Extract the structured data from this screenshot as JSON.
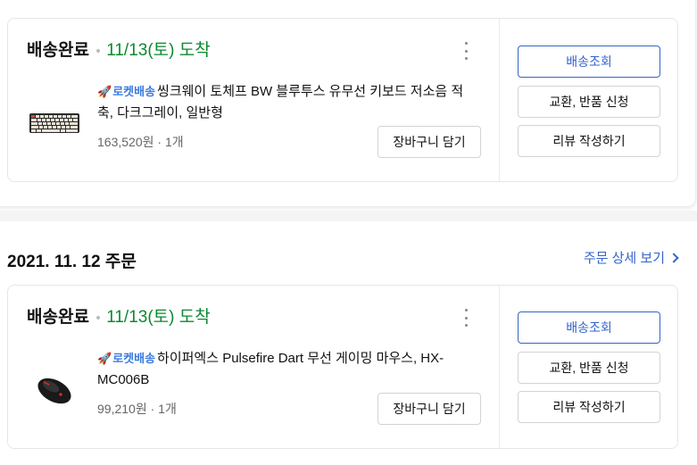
{
  "orders": [
    {
      "status": "배송완료",
      "arrival": "11/13(토) 도착",
      "badge": "로켓배송",
      "product_name": "씽크웨이 토체프 BW 블루투스 유무선 키보드 저소음 적축, 다크그레이, 일반형",
      "price": "163,520원",
      "quantity": "1개",
      "cart_button": "장바구니 담기",
      "actions": {
        "track": "배송조회",
        "return": "교환, 반품 신청",
        "review": "리뷰 작성하기"
      }
    },
    {
      "order_date": "2021. 11. 12 주문",
      "order_detail_link": "주문 상세 보기",
      "status": "배송완료",
      "arrival": "11/13(토) 도착",
      "badge": "로켓배송",
      "product_name": "하이퍼엑스 Pulsefire Dart 무선 게이밍 마우스, HX-MC006B",
      "price": "99,210원",
      "quantity": "1개",
      "cart_button": "장바구니 담기",
      "actions": {
        "track": "배송조회",
        "return": "교환, 반품 신청",
        "review": "리뷰 작성하기"
      }
    }
  ],
  "colors": {
    "arrival_green": "#0a8a2f",
    "link_blue": "#3463c9",
    "badge_blue": "#3a7be0"
  },
  "icons": {
    "badge": "rocket-icon",
    "more": "kebab-menu-icon",
    "link": "chevron-right-icon"
  }
}
